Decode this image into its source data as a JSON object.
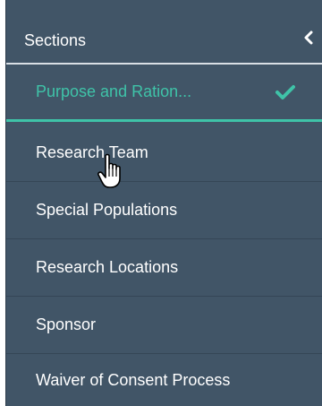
{
  "sidebar": {
    "header": {
      "title": "Sections",
      "collapse_icon": "chevron-left-icon"
    },
    "items": [
      {
        "label": "Purpose and Ration...",
        "status_icon": "check-icon",
        "active": true
      },
      {
        "label": "Research Team"
      },
      {
        "label": "Special Populations"
      },
      {
        "label": "Research Locations"
      },
      {
        "label": "Sponsor"
      },
      {
        "label": "Waiver of Consent Process"
      }
    ]
  },
  "colors": {
    "panel_background": "#415567",
    "active_accent": "#3fc3a8",
    "text": "#ffffff"
  },
  "cursor": "hand-pointer-icon"
}
